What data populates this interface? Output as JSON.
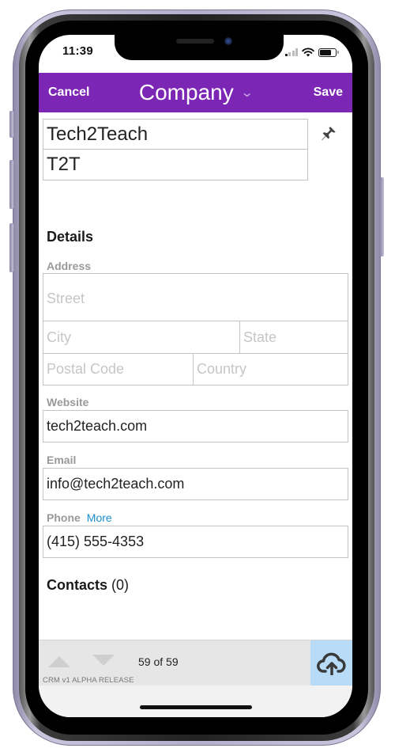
{
  "status_bar": {
    "time": "11:39",
    "signal_bars_active": 1,
    "signal_bars_total": 4,
    "battery_level": 0.75
  },
  "navbar": {
    "cancel_label": "Cancel",
    "title": "Company",
    "title_icon": "chevron-down-icon",
    "save_label": "Save",
    "bg_color": "#7b26b5"
  },
  "company": {
    "name": "Tech2Teach",
    "short_name": "T2T",
    "pin_icon": "pin-icon"
  },
  "details": {
    "section_title": "Details",
    "address": {
      "label": "Address",
      "street_placeholder": "Street",
      "street_value": "",
      "city_placeholder": "City",
      "city_value": "",
      "state_placeholder": "State",
      "state_value": "",
      "postal_placeholder": "Postal Code",
      "postal_value": "",
      "country_placeholder": "Country",
      "country_value": ""
    },
    "website": {
      "label": "Website",
      "value": "tech2teach.com"
    },
    "email": {
      "label": "Email",
      "value": "info@tech2teach.com"
    },
    "phone": {
      "label": "Phone",
      "more_label": "More",
      "value": "(415) 555-4353"
    }
  },
  "contacts": {
    "title": "Contacts",
    "count": "(0)"
  },
  "toolbar": {
    "prev_icon": "arrow-up-icon",
    "next_icon": "arrow-down-icon",
    "record_position": "59 of 59",
    "release_label": "CRM v1 ALPHA RELEASE",
    "sync_icon": "cloud-upload-icon",
    "sync_bg_color": "#b8dcf7"
  }
}
